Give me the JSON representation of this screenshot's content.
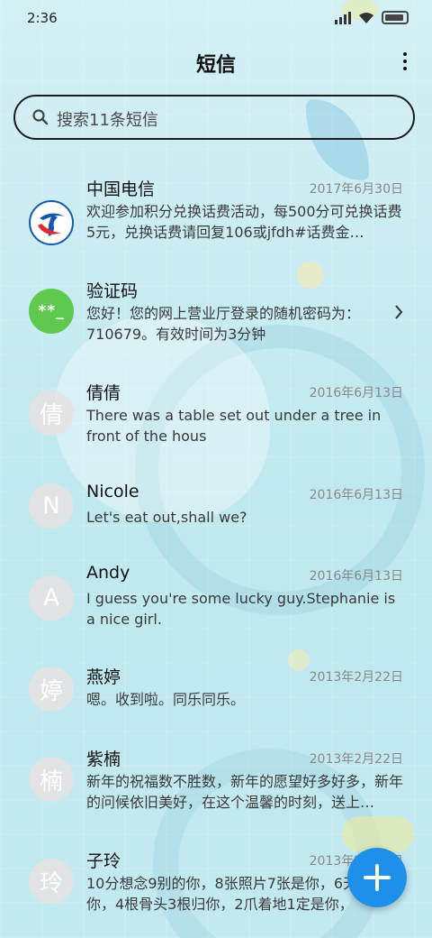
{
  "status_bar": {
    "time": "2:36"
  },
  "header": {
    "title": "短信",
    "more_icon": "more-vertical-icon"
  },
  "search": {
    "placeholder": "搜索11条短信",
    "icon": "search-icon"
  },
  "colors": {
    "accent": "#1e90ea",
    "background": "#cdeef3",
    "green_avatar": "#5ec94e"
  },
  "conversations": [
    {
      "name": "中国电信",
      "date": "2017年6月30日",
      "preview": "欢迎参加积分兑换话费活动，每500分可兑换话费5元，兑换话费请回复106或jfdh#话费金…",
      "avatar_type": "china-telecom-logo"
    },
    {
      "name": "验证码",
      "date": "",
      "preview": "您好！您的网上营业厅登录的随机密码为：710679。有效时间为3分钟",
      "avatar_text": "**_",
      "avatar_type": "green"
    },
    {
      "name": "倩倩",
      "date": "2016年6月13日",
      "preview": "There was a table set out under a tree in front of the hous",
      "avatar_text": "倩",
      "avatar_type": "gray"
    },
    {
      "name": "Nicole",
      "date": "2016年6月13日",
      "preview": "Let's eat out,shall we?",
      "avatar_text": "N",
      "avatar_type": "gray"
    },
    {
      "name": "Andy",
      "date": "2016年6月13日",
      "preview": "I guess you're some lucky guy.Stephanie is a nice girl.",
      "avatar_text": "A",
      "avatar_type": "gray"
    },
    {
      "name": "燕婷",
      "date": "2013年2月22日",
      "preview": "嗯。收到啦。同乐同乐。",
      "avatar_text": "婷",
      "avatar_type": "gray"
    },
    {
      "name": "紫楠",
      "date": "2013年2月22日",
      "preview": "新年的祝福数不胜数，新年的愿望好多好多，新年的问候依旧美好，在这个温馨的时刻，送上…",
      "avatar_text": "楠",
      "avatar_type": "gray"
    },
    {
      "name": "子玲",
      "date": "2013年2月22日",
      "preview": "10分想念9别的你，8张照片7张是你，6天只像你，4根骨头3根归你，2爪着地1定是你，",
      "avatar_text": "玲",
      "avatar_type": "gray"
    }
  ],
  "fab": {
    "icon": "plus-icon"
  }
}
